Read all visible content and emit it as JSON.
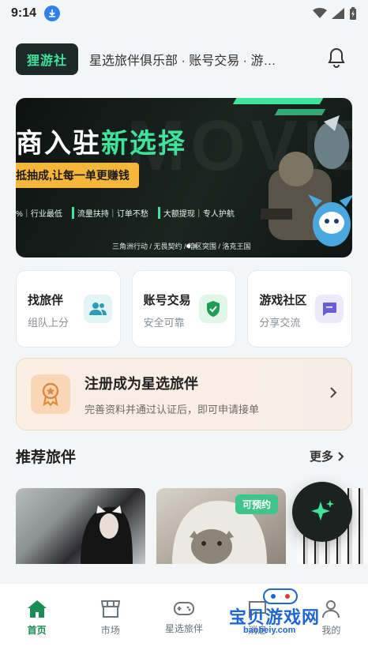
{
  "status": {
    "time": "9:14"
  },
  "header": {
    "logo": "狸游社",
    "slogan": "星选旅伴俱乐部 · 账号交易 · 游…"
  },
  "banner": {
    "title_white": "商入驻",
    "title_green": "新选择",
    "ribbon": "抵抽成,让每一单更赚钱",
    "tags": [
      "%｜行业最低",
      "流量扶持｜订单不愁",
      "大额提现｜专人护航"
    ],
    "footer": "三角洲行动 / 无畏契约 / 暗区突围 / 洛克王国"
  },
  "quick_cards": [
    {
      "title": "找旅伴",
      "sub": "组队上分",
      "icon": "people-icon",
      "bg": "#e2f4f6",
      "fg": "#2a9db3"
    },
    {
      "title": "账号交易",
      "sub": "安全可靠",
      "icon": "shield-check-icon",
      "bg": "#e1f5e8",
      "fg": "#1e9e55"
    },
    {
      "title": "游戏社区",
      "sub": "分享交流",
      "icon": "chat-icon",
      "bg": "#ece9fb",
      "fg": "#6b5bd6"
    }
  ],
  "register": {
    "title": "注册成为星选旅伴",
    "sub": "完善资料并通过认证后，即可申请接单"
  },
  "recommend": {
    "title": "推荐旅伴",
    "more": "更多",
    "badge": "可预约"
  },
  "tabs": [
    {
      "label": "首页",
      "icon": "home-icon",
      "active": true
    },
    {
      "label": "市场",
      "icon": "store-icon",
      "active": false
    },
    {
      "label": "星选旅伴",
      "icon": "gamepad-icon",
      "active": false
    },
    {
      "label": "消息",
      "icon": "message-icon",
      "active": false
    },
    {
      "label": "我的",
      "icon": "user-icon",
      "active": false
    }
  ],
  "watermark": {
    "main": "宝贝游戏网",
    "url": "baobeiy.com"
  },
  "colors": {
    "accent": "#3fe39a",
    "active_tab": "#1a8c55",
    "badge": "#3fc489"
  }
}
